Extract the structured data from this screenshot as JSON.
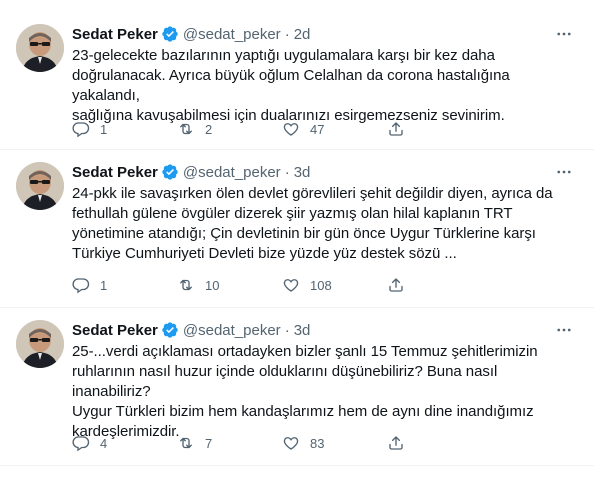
{
  "tweets": [
    {
      "name": "Sedat Peker",
      "handle": "@sedat_peker",
      "separator": "·",
      "time": "2d",
      "text": "23-gelecekte bazılarının yaptığı uygulamalara karşı bir kez daha\ndoğrulanacak. Ayrıca büyük oğlum Celalhan da corona hastalığına yakalandı,\nsağlığına kavuşabilmesi için dualarınızı esirgemezseniz sevinirim.",
      "replies": "1",
      "retweets": "2",
      "likes": "47"
    },
    {
      "name": "Sedat Peker",
      "handle": "@sedat_peker",
      "separator": "·",
      "time": "3d",
      "text": "24-pkk ile savaşırken ölen devlet görevlileri şehit değildir diyen, ayrıca da\nfethullah gülene övgüler dizerek şiir yazmış olan hilal kaplanın TRT\nyönetimine atandığı; Çin devletinin bir gün önce Uygur Türklerine karşı\nTürkiye Cumhuriyeti Devleti bize yüzde yüz destek sözü ...",
      "replies": "1",
      "retweets": "10",
      "likes": "108"
    },
    {
      "name": "Sedat Peker",
      "handle": "@sedat_peker",
      "separator": "·",
      "time": "3d",
      "text": "25-...verdi açıklaması ortadayken bizler şanlı 15 Temmuz şehitlerimizin\nruhlarının nasıl huzur içinde olduklarını düşünebiliriz? Buna nasıl inanabiliriz?\nUygur Türkleri bizim hem kandaşlarımız hem de aynı dine inandığımız\nkardeşlerimizdir.",
      "replies": "4",
      "retweets": "7",
      "likes": "83"
    }
  ],
  "icons": {
    "verified": "verified-badge-icon",
    "more": "more-horizontal-icon",
    "reply": "reply-icon",
    "retweet": "retweet-icon",
    "like": "heart-icon",
    "share": "share-icon"
  },
  "colors": {
    "verified": "#1d9bf0",
    "secondary_text": "#536471",
    "primary_text": "#0f1419",
    "divider": "#eff3f4"
  }
}
